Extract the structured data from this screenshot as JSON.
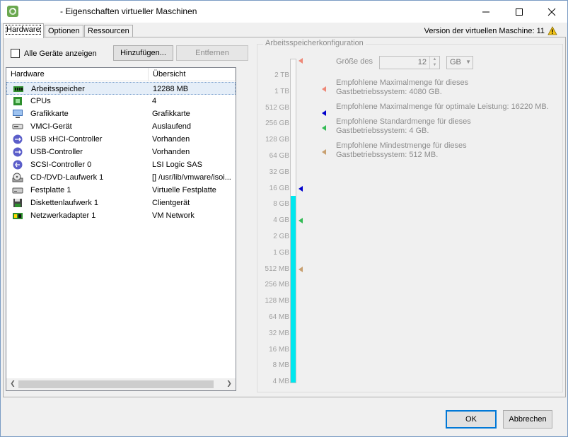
{
  "window": {
    "title": "- Eigenschaften virtueller Maschinen",
    "app_icon": "vsphere-logo-icon"
  },
  "tabs": [
    {
      "label": "Hardware",
      "active": true
    },
    {
      "label": "Optionen",
      "active": false
    },
    {
      "label": "Ressourcen",
      "active": false
    }
  ],
  "version": {
    "label": "Version der virtuellen Maschine: 11",
    "icon": "warning-icon"
  },
  "toolbar": {
    "show_all_label": "Alle Geräte anzeigen",
    "show_all_checked": false,
    "add_label": "Hinzufügen...",
    "remove_label": "Entfernen"
  },
  "hardware_table": {
    "columns": [
      "Hardware",
      "Übersicht"
    ],
    "rows": [
      {
        "icon": "memory-icon",
        "name": "Arbeitsspeicher",
        "summary": "12288 MB",
        "selected": true
      },
      {
        "icon": "cpu-icon",
        "name": "CPUs",
        "summary": "4"
      },
      {
        "icon": "monitor-icon",
        "name": "Grafikkarte",
        "summary": "Grafikkarte"
      },
      {
        "icon": "vmci-device-icon",
        "name": "VMCI-Gerät",
        "summary": "Auslaufend"
      },
      {
        "icon": "usb-icon",
        "name": "USB xHCI-Controller",
        "summary": "Vorhanden"
      },
      {
        "icon": "usb-icon",
        "name": "USB-Controller",
        "summary": "Vorhanden"
      },
      {
        "icon": "scsi-icon",
        "name": "SCSI-Controller 0",
        "summary": "LSI Logic SAS"
      },
      {
        "icon": "cd-dvd-icon",
        "name": "CD-/DVD-Laufwerk 1",
        "summary": "[] /usr/lib/vmware/isoi..."
      },
      {
        "icon": "hard-disk-icon",
        "name": "Festplatte 1",
        "summary": "Virtuelle Festplatte"
      },
      {
        "icon": "floppy-icon",
        "name": "Diskettenlaufwerk 1",
        "summary": "Clientgerät"
      },
      {
        "icon": "network-adapter-icon",
        "name": "Netzwerkadapter 1",
        "summary": "VM Network"
      }
    ]
  },
  "memory_config": {
    "group_title": "Arbeitsspeicherkonfiguration",
    "size_label": "Größe des",
    "size_value": "12",
    "unit_value": "GB",
    "ticks": [
      "2 TB",
      "1 TB",
      "512 GB",
      "256 GB",
      "128 GB",
      "64 GB",
      "32 GB",
      "16 GB",
      "8 GB",
      "4 GB",
      "2 GB",
      "1 GB",
      "512 MB",
      "256 MB",
      "128 MB",
      "64 MB",
      "32 MB",
      "16 MB",
      "8 MB",
      "4 MB"
    ],
    "slider_fill_from_tick": 8,
    "legend": [
      {
        "color": "#ee8877",
        "line1": "Empfohlene Maximalmenge für dieses",
        "line2": "Gastbetriebssystem: 4080 GB."
      },
      {
        "color": "#0000cc",
        "line1": "Empfohlene Maximalmenge für optimale Leistung: 16220 MB.",
        "line2": ""
      },
      {
        "color": "#33bb55",
        "line1": "Empfohlene Standardmenge für dieses",
        "line2": "Gastbetriebssystem: 4 GB."
      },
      {
        "color": "#c8a070",
        "line1": "Empfohlene Mindestmenge für dieses",
        "line2": "Gastbetriebssystem: 512 MB."
      }
    ],
    "markers": [
      {
        "color": "#ee8877",
        "tick_index": -0.9
      },
      {
        "color": "#0000cc",
        "tick_index": 7
      },
      {
        "color": "#33bb55",
        "tick_index": 9
      },
      {
        "color": "#c8a070",
        "tick_index": 12
      }
    ]
  },
  "footer": {
    "ok_label": "OK",
    "cancel_label": "Abbrechen"
  }
}
